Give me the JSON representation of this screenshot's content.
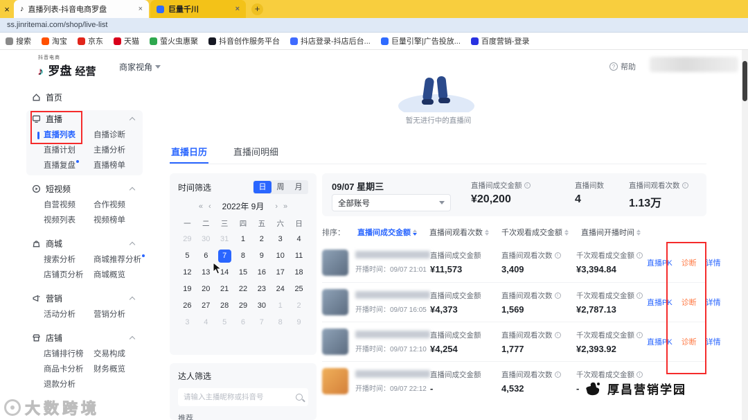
{
  "browser": {
    "window_close": "×",
    "tabs": [
      {
        "title": "直播列表-抖音电商罗盘",
        "favicon": "douyin",
        "close": "×"
      },
      {
        "title": "巨量千川",
        "favicon": "qianchuan",
        "close": "×"
      }
    ],
    "new_tab_label": "+",
    "url": "ss.jinritemai.com/shop/live-list",
    "bookmarks": [
      {
        "label": "搜索",
        "color": "#8a8a8a"
      },
      {
        "label": "淘宝",
        "color": "#ff5000"
      },
      {
        "label": "京东",
        "color": "#e1251b"
      },
      {
        "label": "天猫",
        "color": "#d9001b"
      },
      {
        "label": "萤火虫惠聚",
        "color": "#2fa84f"
      },
      {
        "label": "抖音创作服务平台",
        "color": "#161823"
      },
      {
        "label": "抖店登录-抖店后台...",
        "color": "#3f6bff"
      },
      {
        "label": "巨量引擎|广告投放...",
        "color": "#2f6bff"
      },
      {
        "label": "百度营销-登录",
        "color": "#2932e1"
      }
    ]
  },
  "topbar": {
    "brand_tag": "抖音电商",
    "brand_main": "罗盘",
    "brand_sub": "经营",
    "view_switch": "商家视角",
    "help": "帮助"
  },
  "sidebar": {
    "home": "首页",
    "sections": [
      {
        "id": "live",
        "title": "直播",
        "highlight": true,
        "items": [
          {
            "label": "直播列表",
            "active": true
          },
          {
            "label": "自播诊断"
          },
          {
            "label": "直播计划"
          },
          {
            "label": "主播分析"
          },
          {
            "label": "直播复盘",
            "badge": true
          },
          {
            "label": "直播榜单"
          }
        ]
      },
      {
        "id": "video",
        "title": "短视频",
        "items": [
          {
            "label": "自营视频"
          },
          {
            "label": "合作视频"
          },
          {
            "label": "视频列表"
          },
          {
            "label": "视频榜单"
          }
        ]
      },
      {
        "id": "mall",
        "title": "商城",
        "items": [
          {
            "label": "搜索分析"
          },
          {
            "label": "商城推荐分析",
            "badge": true
          },
          {
            "label": "店铺页分析"
          },
          {
            "label": "商城概览"
          }
        ]
      },
      {
        "id": "marketing",
        "title": "营销",
        "items": [
          {
            "label": "活动分析"
          },
          {
            "label": "营销分析"
          }
        ]
      },
      {
        "id": "shop",
        "title": "店铺",
        "items": [
          {
            "label": "店铺排行榜"
          },
          {
            "label": "交易构成"
          },
          {
            "label": "商品卡分析"
          },
          {
            "label": "财务概览"
          },
          {
            "label": "退款分析"
          }
        ]
      }
    ]
  },
  "main": {
    "empty_live_caption": "暂无进行中的直播间",
    "tabs": [
      {
        "label": "直播日历",
        "active": true
      },
      {
        "label": "直播间明细"
      }
    ]
  },
  "calendar": {
    "filter_title": "时间筛选",
    "modes": [
      {
        "label": "日",
        "active": true
      },
      {
        "label": "周"
      },
      {
        "label": "月"
      }
    ],
    "nav": {
      "prev_year": "«",
      "prev_month": "‹",
      "label": "2022年 9月",
      "next_month": "›",
      "next_year": "»"
    },
    "day_headers": [
      "一",
      "二",
      "三",
      "四",
      "五",
      "六",
      "日"
    ],
    "weeks": [
      [
        29,
        30,
        31,
        1,
        2,
        3,
        4
      ],
      [
        5,
        6,
        7,
        8,
        9,
        10,
        11
      ],
      [
        12,
        13,
        14,
        15,
        16,
        17,
        18
      ],
      [
        19,
        20,
        21,
        22,
        23,
        24,
        25
      ],
      [
        26,
        27,
        28,
        29,
        30,
        1,
        2
      ],
      [
        3,
        4,
        5,
        6,
        7,
        8,
        9
      ]
    ],
    "selected": {
      "week": 1,
      "day_index": 2,
      "value": 7
    }
  },
  "talent_filter": {
    "title": "达人筛选",
    "search_placeholder": "请输入主播昵称或抖音号",
    "recommend_label": "推荐"
  },
  "day_summary": {
    "date": "09/07 星期三",
    "account_select": "全部账号",
    "stats": [
      {
        "label": "直播间成交金额",
        "value": "¥20,200",
        "info": true
      },
      {
        "label": "直播间数",
        "value": "4"
      },
      {
        "label": "直播间观看次数",
        "value": "1.13万",
        "info": true
      }
    ]
  },
  "sort_bar": {
    "label": "排序：",
    "options": [
      {
        "label": "直播间成交金额",
        "active": true
      },
      {
        "label": "直播间观看次数"
      },
      {
        "label": "千次观看成交金额"
      },
      {
        "label": "直播间开播时间"
      }
    ]
  },
  "live_rows": [
    {
      "start_time": "开播时间：09/07 21:01",
      "avatar": "gray",
      "gmv_label": "直播间成交金额",
      "gmv": "¥11,573",
      "views_label": "直播间观看次数",
      "views": "3,409",
      "per_label": "千次观看成交金额",
      "per": "¥3,394.84",
      "actions": [
        {
          "label": "直播PK",
          "style": "blue"
        },
        {
          "label": "诊断",
          "style": "orange"
        },
        {
          "label": "详情",
          "style": "blue"
        }
      ]
    },
    {
      "start_time": "开播时间：09/07 16:05",
      "avatar": "gray",
      "gmv_label": "直播间成交金额",
      "gmv": "¥4,373",
      "views_label": "直播间观看次数",
      "views": "1,569",
      "per_label": "千次观看成交金额",
      "per": "¥2,787.13",
      "actions": [
        {
          "label": "直播PK",
          "style": "blue"
        },
        {
          "label": "诊断",
          "style": "orange"
        },
        {
          "label": "详情",
          "style": "blue"
        }
      ]
    },
    {
      "start_time": "开播时间：09/07 12:10",
      "avatar": "gray",
      "gmv_label": "直播间成交金额",
      "gmv": "¥4,254",
      "views_label": "直播间观看次数",
      "views": "1,777",
      "per_label": "千次观看成交金额",
      "per": "¥2,393.92",
      "actions": [
        {
          "label": "直播PK",
          "style": "blue"
        },
        {
          "label": "诊断",
          "style": "orange"
        },
        {
          "label": "详情",
          "style": "blue"
        }
      ]
    },
    {
      "start_time": "开播时间：09/07 22:12",
      "avatar": "orange",
      "gmv_label": "直播间成交金额",
      "gmv": "-",
      "views_label": "直播间观看次数",
      "views": "4,532",
      "per_label": "千次观看成交金额",
      "per": "-",
      "actions": []
    }
  ],
  "watermarks": {
    "bottom_left": "大数跨境",
    "bottom_right": "厚昌营销学园"
  },
  "colors": {
    "accent_blue": "#2a66ff",
    "action_orange": "#ff7a45",
    "annotation_red": "#f52b2b",
    "browser_yellow": "#f8ce3e"
  }
}
